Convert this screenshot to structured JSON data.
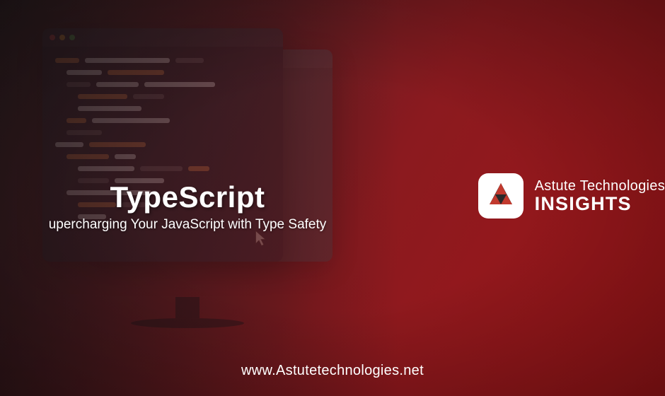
{
  "hero": {
    "title": "TypeScript",
    "subtitle": "upercharging Your JavaScript with Type Safety"
  },
  "brand": {
    "line1": "Astute Technologies",
    "line2": "INSIGHTS"
  },
  "footer": {
    "url": "www.Astutetechnologies.net"
  }
}
